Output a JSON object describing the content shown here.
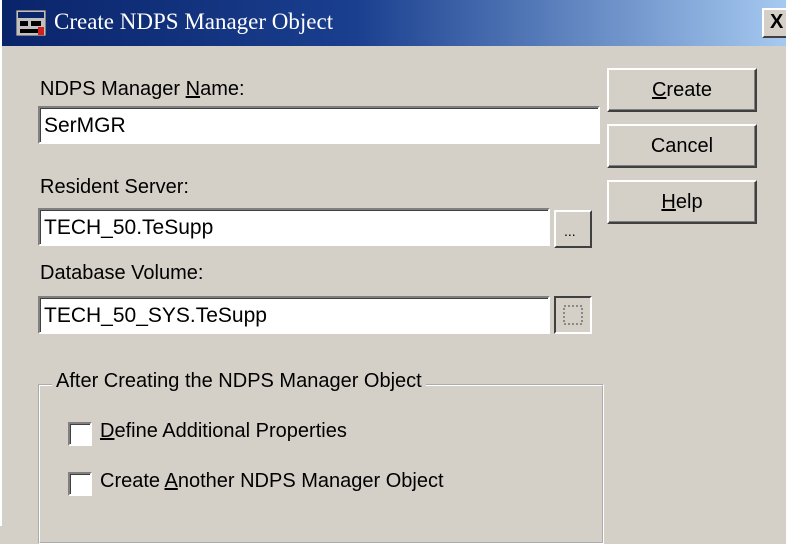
{
  "window": {
    "title": "Create NDPS Manager Object",
    "close_label": "X"
  },
  "form": {
    "manager_name": {
      "label_pre": "NDPS Manager ",
      "label_key": "N",
      "label_post": "ame:",
      "value": "SerMGR"
    },
    "resident_server": {
      "label": "Resident Server:",
      "value": "TECH_50.TeSupp",
      "browse_label": "..."
    },
    "database_volume": {
      "label": "Database Volume:",
      "value": "TECH_50_SYS.TeSupp"
    }
  },
  "buttons": {
    "create": {
      "key": "C",
      "rest": "reate"
    },
    "cancel": {
      "label": "Cancel"
    },
    "help": {
      "key": "H",
      "rest": "elp"
    }
  },
  "after_group": {
    "legend": "After Creating the NDPS Manager Object",
    "options": [
      {
        "pre": "",
        "key": "D",
        "post": "efine Additional Properties",
        "checked": false
      },
      {
        "pre": "Create ",
        "key": "A",
        "post": "nother NDPS Manager Object",
        "checked": false
      }
    ]
  }
}
